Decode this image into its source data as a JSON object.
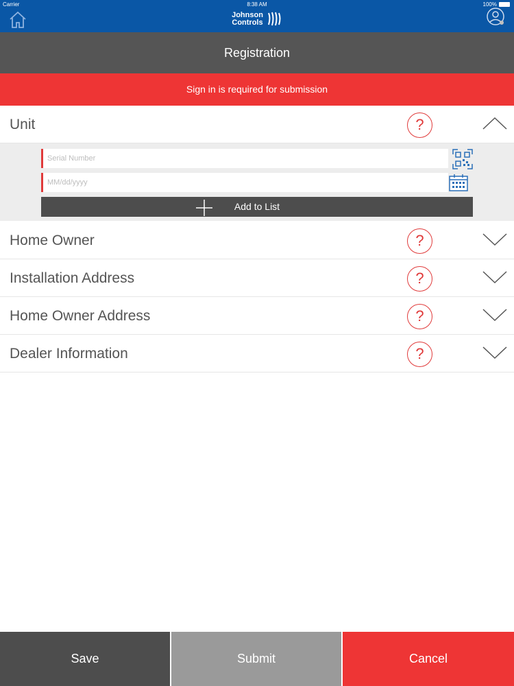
{
  "status": {
    "carrier": "Carrier",
    "time": "8:38 AM",
    "battery": "100%"
  },
  "brand": {
    "line1": "Johnson",
    "line2": "Controls"
  },
  "title": "Registration",
  "alert": "Sign in is required for submission",
  "sections": [
    {
      "label": "Unit",
      "help": "?",
      "expanded": true
    },
    {
      "label": "Home Owner",
      "help": "?",
      "expanded": false
    },
    {
      "label": "Installation Address",
      "help": "?",
      "expanded": false
    },
    {
      "label": "Home Owner Address",
      "help": "?",
      "expanded": false
    },
    {
      "label": "Dealer Information",
      "help": "?",
      "expanded": false
    }
  ],
  "unit": {
    "serial_placeholder": "Serial Number",
    "serial_value": "",
    "date_placeholder": "MM/dd/yyyy",
    "date_value": "",
    "add_label": "Add to List"
  },
  "buttons": {
    "save": "Save",
    "submit": "Submit",
    "cancel": "Cancel"
  },
  "colors": {
    "header": "#0a57a6",
    "titlebar": "#555555",
    "alert": "#ee3535",
    "accent_red": "#e03a3a",
    "submit": "#9a9a9a"
  }
}
